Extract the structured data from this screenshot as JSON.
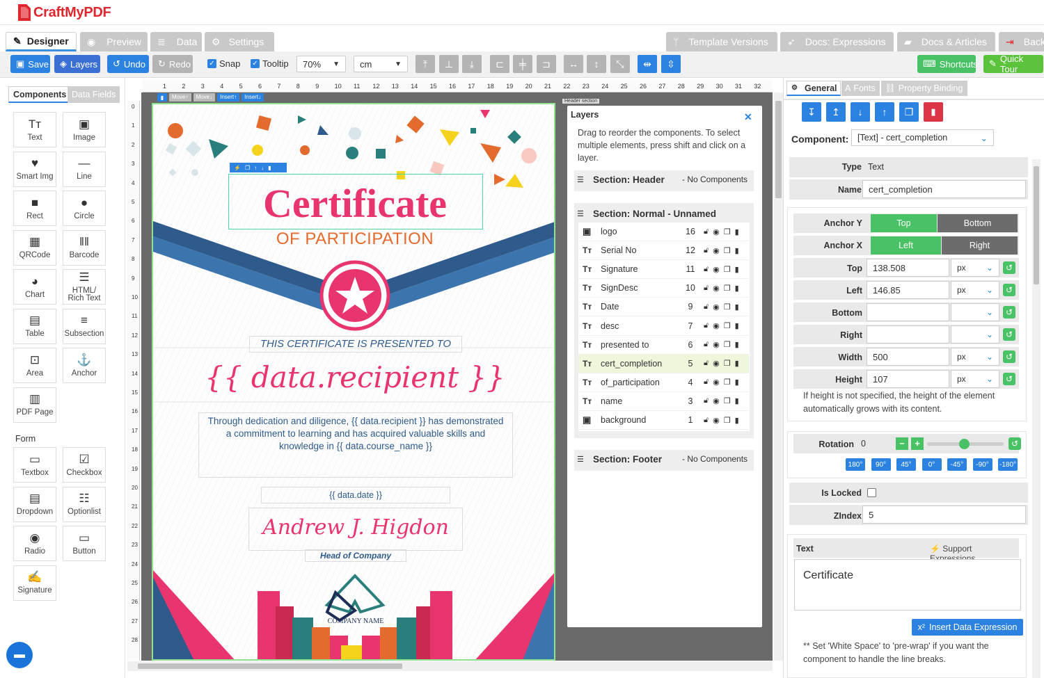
{
  "app": {
    "brand": "CraftMyPDF"
  },
  "tabs": {
    "designer": "Designer",
    "preview": "Preview",
    "data": "Data",
    "settings": "Settings",
    "template_versions": "Template Versions",
    "docs_expressions": "Docs: Expressions",
    "docs_articles": "Docs & Articles",
    "back": "Back"
  },
  "toolbar": {
    "save": "Save",
    "layers": "Layers",
    "undo": "Undo",
    "redo": "Redo",
    "snap": "Snap",
    "tooltip": "Tooltip",
    "zoom": "70%",
    "unit": "cm",
    "shortcuts": "Shortcuts",
    "quick_tour": "Quick Tour"
  },
  "left": {
    "tab_components": "Components",
    "tab_data_fields": "Data Fields",
    "components": [
      {
        "label": "Text",
        "icon": "text-icon"
      },
      {
        "label": "Image",
        "icon": "image-icon"
      },
      {
        "label": "Smart Img",
        "icon": "heart-icon"
      },
      {
        "label": "Line",
        "icon": "line-icon"
      },
      {
        "label": "Rect",
        "icon": "rect-icon"
      },
      {
        "label": "Circle",
        "icon": "circle-icon"
      },
      {
        "label": "QRCode",
        "icon": "qrcode-icon"
      },
      {
        "label": "Barcode",
        "icon": "barcode-icon"
      },
      {
        "label": "Chart",
        "icon": "chart-icon"
      },
      {
        "label": "HTML/ Rich Text",
        "icon": "html-icon"
      },
      {
        "label": "Table",
        "icon": "table-icon"
      },
      {
        "label": "Subsection",
        "icon": "subsection-icon"
      },
      {
        "label": "Area",
        "icon": "area-icon"
      },
      {
        "label": "Anchor",
        "icon": "anchor-icon"
      },
      {
        "label": "PDF Page",
        "icon": "pdf-icon"
      }
    ],
    "form_heading": "Form",
    "form_components": [
      {
        "label": "Textbox",
        "icon": "textbox-icon"
      },
      {
        "label": "Checkbox",
        "icon": "checkbox-icon"
      },
      {
        "label": "Dropdown",
        "icon": "dropdown-icon"
      },
      {
        "label": "Optionlist",
        "icon": "optionlist-icon"
      },
      {
        "label": "Radio",
        "icon": "radio-icon"
      },
      {
        "label": "Button",
        "icon": "button-icon"
      },
      {
        "label": "Signature",
        "icon": "signature-icon"
      }
    ]
  },
  "rulers": {
    "top": [
      "1",
      "2",
      "3",
      "4",
      "5",
      "6",
      "7",
      "8",
      "9",
      "10",
      "11",
      "12",
      "13",
      "14",
      "15",
      "16",
      "17",
      "18",
      "19",
      "20",
      "21",
      "22",
      "23",
      "24",
      "25",
      "26",
      "27",
      "28",
      "29",
      "30",
      "31",
      "32"
    ],
    "left": [
      "0",
      "1",
      "2",
      "3",
      "4",
      "5",
      "6",
      "7",
      "8",
      "9",
      "10",
      "11",
      "12",
      "13",
      "14",
      "15",
      "16",
      "17",
      "18",
      "19",
      "20",
      "21",
      "22",
      "23",
      "24",
      "25",
      "26",
      "27",
      "28"
    ]
  },
  "canvas": {
    "move_up": "Move",
    "move_down": "Move",
    "insert_up": "Insert",
    "insert_down": "Insert",
    "header_section": "Header section",
    "title": "Certificate",
    "subtitle": "OF PARTICIPATION",
    "presented": "THIS CERTIFICATE IS PRESENTED TO",
    "recipient": "{{ data.recipient }}",
    "desc": "Through dedication and diligence, {{ data.recipient }} has demonstrated a commitment to learning and has acquired valuable skills and knowledge in {{ data.course_name }}",
    "date": "{{ data.date }}",
    "signature": "Andrew J. Higdon",
    "sign_desc": "Head of Company",
    "company": "COMPANY NAME"
  },
  "layers": {
    "title": "Layers",
    "hint": "Drag to reorder the components. To select multiple elements, press shift and click on a layer.",
    "header": {
      "label": "Section: Header",
      "note": "- No Components"
    },
    "normal": {
      "label": "Section: Normal - Unnamed"
    },
    "footer": {
      "label": "Section: Footer",
      "note": "- No Components"
    },
    "items": [
      {
        "name": "logo",
        "z": "16",
        "type": "image"
      },
      {
        "name": "Serial No",
        "z": "12",
        "type": "text"
      },
      {
        "name": "Signature",
        "z": "11",
        "type": "text"
      },
      {
        "name": "SignDesc",
        "z": "10",
        "type": "text"
      },
      {
        "name": "Date",
        "z": "9",
        "type": "text"
      },
      {
        "name": "desc",
        "z": "7",
        "type": "text"
      },
      {
        "name": "presented to",
        "z": "6",
        "type": "text"
      },
      {
        "name": "cert_completion",
        "z": "5",
        "type": "text"
      },
      {
        "name": "of_participation",
        "z": "4",
        "type": "text"
      },
      {
        "name": "name",
        "z": "3",
        "type": "text"
      },
      {
        "name": "background",
        "z": "1",
        "type": "image"
      }
    ]
  },
  "props": {
    "tab_general": "General",
    "tab_fonts": "Fonts",
    "tab_binding": "Property Binding",
    "component_label": "Component:",
    "component_value": "[Text] - cert_completion",
    "type_label": "Type",
    "type_value": "Text",
    "name_label": "Name",
    "name_value": "cert_completion",
    "anchor_y": "Anchor Y",
    "anchor_y_top": "Top",
    "anchor_y_bottom": "Bottom",
    "anchor_x": "Anchor X",
    "anchor_x_left": "Left",
    "anchor_x_right": "Right",
    "top_label": "Top",
    "top_value": "138.508",
    "top_unit": "px",
    "left_label": "Left",
    "left_value": "146.85",
    "left_unit": "px",
    "bottom_label": "Bottom",
    "bottom_value": "",
    "bottom_unit": "",
    "right_label": "Right",
    "right_value": "",
    "right_unit": "",
    "width_label": "Width",
    "width_value": "500",
    "width_unit": "px",
    "height_label": "Height",
    "height_value": "107",
    "height_unit": "px",
    "height_note": "If height is not specified, the height of the element automatically grows with its content.",
    "rotation_label": "Rotation",
    "rotation_value": "0",
    "rotation_presets": [
      "180°",
      "90°",
      "45°",
      "0°",
      "-45°",
      "-90°",
      "-180°"
    ],
    "locked_label": "Is Locked",
    "zindex_label": "ZIndex",
    "zindex_value": "5",
    "text_label": "Text",
    "support_expr": "Support Expressions",
    "text_value": "Certificate",
    "insert_expr": "Insert Data Expression",
    "whitespace_note": "** Set 'White Space' to 'pre-wrap' if you want the component to handle the line breaks."
  },
  "colors": {
    "accent": "#2c82e0",
    "green": "#49c266",
    "pink": "#e8356d",
    "navy": "#2e5b8c",
    "orange": "#e36b2e"
  }
}
